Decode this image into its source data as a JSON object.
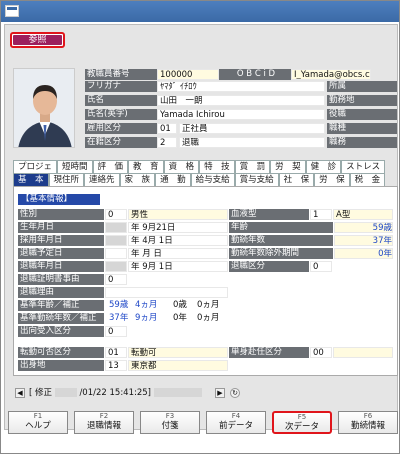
{
  "ref_button": "参照",
  "employee": {
    "lbl_no": "教職員番号",
    "no": "100000",
    "lbl_obcid": "O B C i D",
    "obcid": "I_Yamada@obcs.co",
    "lbl_kana": "フリガナ",
    "kana": "ﾔﾏﾀﾞ ｲﾁﾛｳ",
    "lbl_name": "氏名",
    "name": "山田　一朗",
    "lbl_name_en": "氏名(英字)",
    "name_en": "Yamada Ichirou",
    "lbl_emp_type": "雇用区分",
    "emp_type_code": "01",
    "emp_type": "正社員",
    "lbl_status": "在籍区分",
    "status_code": "2",
    "status": "退職",
    "lbl_dept": "所属",
    "lbl_location": "勤務地",
    "lbl_post": "役職",
    "lbl_rank": "職種",
    "lbl_duty": "職務"
  },
  "tabs_row1": [
    "プロジェ",
    "短時間",
    "評　価",
    "教　育",
    "資　格",
    "特　技",
    "賞　罰",
    "労　契",
    "健　診",
    "ストレス"
  ],
  "tabs_row2": [
    "基　本",
    "現住所",
    "連絡先",
    "家　族",
    "通　勤",
    "給与支給",
    "賞与支給",
    "社　保",
    "労　保",
    "税　金"
  ],
  "basic": {
    "section": "【基本情報】",
    "gender_lbl": "性別",
    "gender_code": "0",
    "gender": "男性",
    "blood_lbl": "血液型",
    "blood_code": "1",
    "blood": "A型",
    "birth_lbl": "生年月日",
    "birth": "年  9月21日",
    "age_lbl": "年齢",
    "age": "59歳",
    "hire_lbl": "採用年月日",
    "hire": "年  4月  1日",
    "service_lbl": "勤続年数",
    "service": "37年",
    "planned_lbl": "退職予定日",
    "planned": "年    月    日",
    "excl_lbl": "勤続年数除外期間",
    "excl": "0年",
    "retire_lbl": "退職年月日",
    "retire": "年  9月  1日",
    "retire_type_lbl": "退職区分",
    "retire_type": "0",
    "cert_lbl": "退職証明書事由",
    "cert": "0",
    "reason_lbl": "退職理由",
    "base_age_lbl": "基準年齢／補正",
    "base_age1": "59歳",
    "base_age2": "4ヵ月",
    "base_age3": "0歳",
    "base_age4": "0ヵ月",
    "base_svc_lbl": "基準勤続年数／補正",
    "base_svc1": "37年",
    "base_svc2": "9ヵ月",
    "base_svc3": "0年",
    "base_svc4": "0ヵ月",
    "secondment_lbl": "出向受入区分",
    "secondment": "0",
    "transfer_lbl": "転勤可否区分",
    "transfer_code": "01",
    "transfer": "転勤可",
    "single_lbl": "単身赴任区分",
    "single": "00",
    "origin_lbl": "出身地",
    "origin_code": "13",
    "origin": "東京都"
  },
  "nav": {
    "prefix": "[ 修正",
    "date": "/01/22 15:41:25]"
  },
  "fkeys": [
    {
      "key": "F1",
      "label": "ヘルプ"
    },
    {
      "key": "F2",
      "label": "退職情報"
    },
    {
      "key": "F3",
      "label": "付箋"
    },
    {
      "key": "F4",
      "label": "前データ"
    },
    {
      "key": "F5",
      "label": "次データ"
    },
    {
      "key": "F6",
      "label": "勤続情報"
    }
  ]
}
